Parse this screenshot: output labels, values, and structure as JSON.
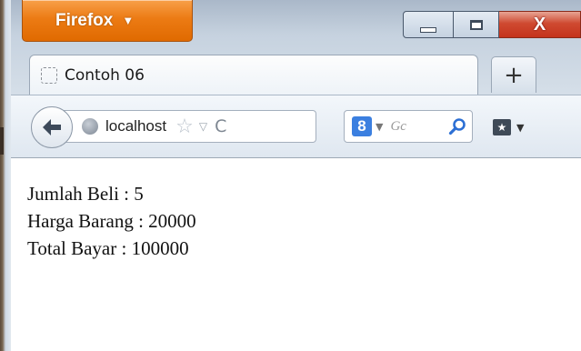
{
  "app": {
    "menu_button": "Firefox",
    "menu_caret": "▼"
  },
  "window_controls": {
    "close_label": "X"
  },
  "tabs": [
    {
      "label": "Contoh 06",
      "active": true
    }
  ],
  "new_tab_label": "+",
  "navbar": {
    "url": "localhost",
    "reload_glyph": "C",
    "search_engine_letter": "8",
    "search_placeholder": "Gc"
  },
  "page": {
    "lines": [
      "Jumlah Beli : 5",
      "Harga Barang : 20000",
      "Total Bayar : 100000"
    ]
  },
  "colors": {
    "firefox_button": "#e87510",
    "close_button": "#c4331c",
    "search_engine": "#3b7fe0"
  }
}
